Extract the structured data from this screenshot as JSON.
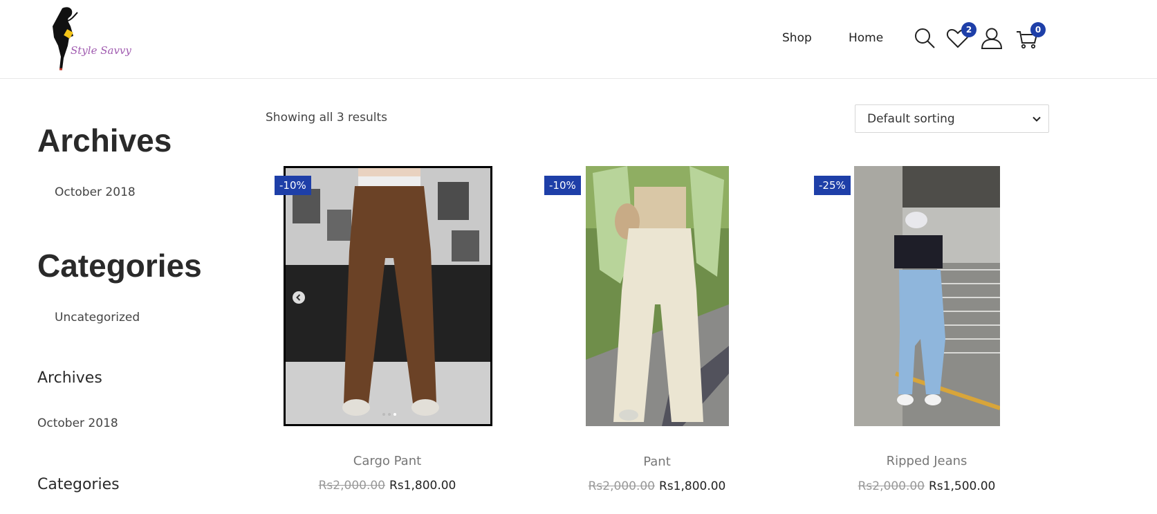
{
  "header": {
    "logo_text": "Style Savvy",
    "nav": {
      "shop": "Shop",
      "home": "Home"
    },
    "wishlist_count": "2",
    "cart_count": "0"
  },
  "sidebar": {
    "block1": {
      "heading": "Archives",
      "item": "October 2018"
    },
    "block2": {
      "heading": "Categories",
      "item": "Uncategorized"
    },
    "block3": {
      "heading": "Archives",
      "item": "October 2018"
    },
    "block4": {
      "heading": "Categories"
    }
  },
  "shop": {
    "result_count": "Showing all 3 results",
    "sort_selected": "Default sorting"
  },
  "products": [
    {
      "title": "Cargo Pant",
      "sale": "-10%",
      "old_price": "Rs2,000.00",
      "price": "Rs1,800.00"
    },
    {
      "title": "Pant",
      "sale": "-10%",
      "old_price": "Rs2,000.00",
      "price": "Rs1,800.00"
    },
    {
      "title": "Ripped Jeans",
      "sale": "-25%",
      "old_price": "Rs2,000.00",
      "price": "Rs1,500.00"
    }
  ],
  "colors": {
    "accent": "#1e3fa8",
    "logo_text": "#a05bb0"
  },
  "icons": [
    "search-icon",
    "heart-icon",
    "user-icon",
    "cart-icon",
    "chevron-down-icon",
    "chevron-left-icon"
  ]
}
